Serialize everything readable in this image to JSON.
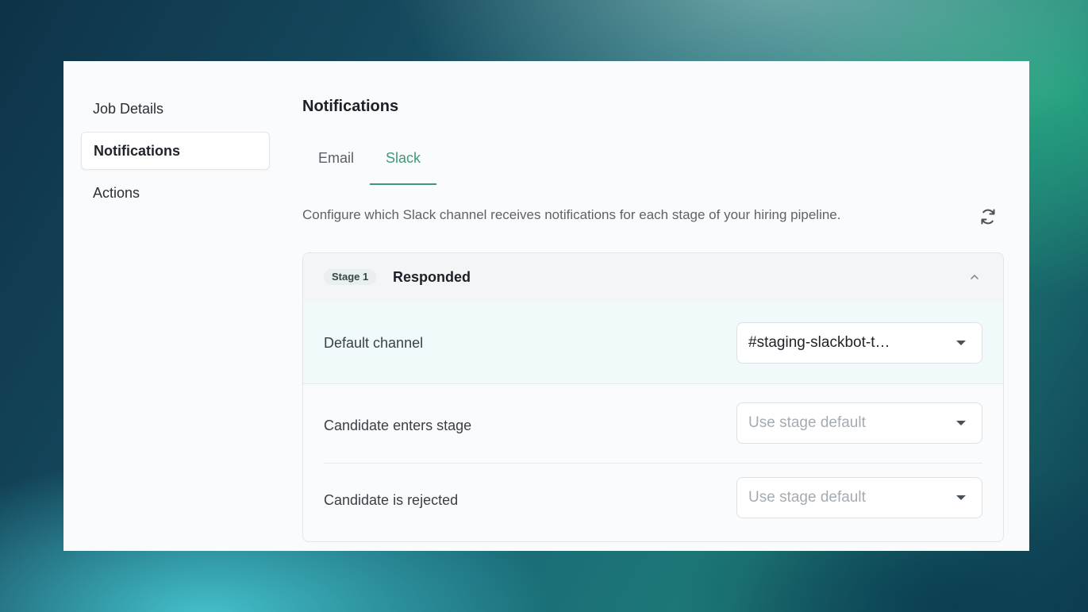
{
  "sidebar": {
    "items": [
      {
        "label": "Job Details",
        "active": false
      },
      {
        "label": "Notifications",
        "active": true
      },
      {
        "label": "Actions",
        "active": false
      }
    ]
  },
  "main": {
    "title": "Notifications",
    "tabs": [
      {
        "label": "Email",
        "active": false
      },
      {
        "label": "Slack",
        "active": true
      }
    ],
    "description": "Configure which Slack channel receives notifications for each stage of your hiring pipeline.",
    "refresh_icon": "refresh-icon"
  },
  "stage": {
    "badge": "Stage 1",
    "name": "Responded",
    "expanded": true,
    "rows": [
      {
        "label": "Default channel",
        "value": "#staging-slackbot-t…",
        "placeholder": false
      },
      {
        "label": "Candidate enters stage",
        "value": "Use stage default",
        "placeholder": true
      },
      {
        "label": "Candidate is rejected",
        "value": "Use stage default",
        "placeholder": true
      }
    ]
  },
  "colors": {
    "accent": "#3d9a7a",
    "panel_bg": "#fafbfc",
    "default_row_bg": "#f1fafb"
  }
}
